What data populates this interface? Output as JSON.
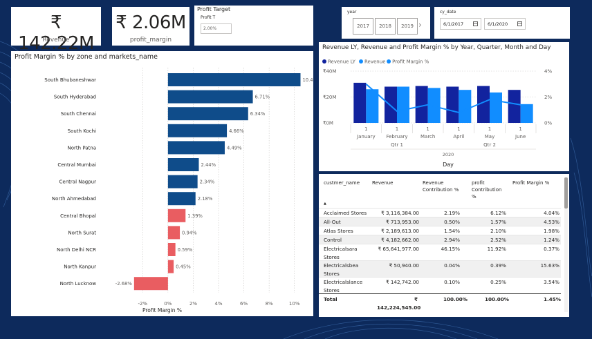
{
  "kpis": {
    "revenue": {
      "value": "₹ 142.22M",
      "label": "Revenue"
    },
    "profit_margin": {
      "value": "₹ 2.06M",
      "label": "profit_margin"
    }
  },
  "profit_target": {
    "title": "Profit Target",
    "sub_label": "Profit T",
    "value": "2.00%"
  },
  "year_slicer": {
    "label": "year",
    "options": [
      "2017",
      "2018",
      "2019"
    ]
  },
  "date_slicer": {
    "label": "cy_date",
    "start": "6/1/2017",
    "end": "6/1/2020"
  },
  "bar_chart": {
    "title": "Profit Margin % by zone and markets_name",
    "xlabel": "Profit Margin %"
  },
  "combo_chart": {
    "title": "Revenue LY, Revenue and Profit Margin % by Year, Quarter, Month and Day",
    "year_label": "2020",
    "axis_title": "Day",
    "quarters": [
      "Qtr 1",
      "Qtr 2"
    ]
  },
  "table": {
    "headers": {
      "customer": "custmer_name",
      "revenue": "Revenue",
      "rev_contrib": [
        "Revenue",
        "Contribution %"
      ],
      "profit_contrib": [
        "profit",
        "Contribution",
        "%"
      ],
      "pm": "Profit Margin %"
    },
    "sort_indicator": "▲",
    "rows": [
      {
        "name": [
          "Acclaimed Stores"
        ],
        "revenue": "₹ 3,116,384.00",
        "rev_contrib": "2.19%",
        "profit_contrib": "6.12%",
        "pm": "4.04%"
      },
      {
        "name": [
          "All-Out"
        ],
        "revenue": "₹ 713,953.00",
        "rev_contrib": "0.50%",
        "profit_contrib": "1.57%",
        "pm": "4.53%"
      },
      {
        "name": [
          "Atlas Stores"
        ],
        "revenue": "₹ 2,189,613.00",
        "rev_contrib": "1.54%",
        "profit_contrib": "2.10%",
        "pm": "1.98%"
      },
      {
        "name": [
          "Control"
        ],
        "revenue": "₹ 4,182,662.00",
        "rev_contrib": "2.94%",
        "profit_contrib": "2.52%",
        "pm": "1.24%"
      },
      {
        "name": [
          "Electricalsara",
          "Stores"
        ],
        "revenue": "₹ 65,641,977.00",
        "rev_contrib": "46.15%",
        "profit_contrib": "11.92%",
        "pm": "0.37%"
      },
      {
        "name": [
          "Electricalsbea",
          "Stores"
        ],
        "revenue": "₹ 50,940.00",
        "rev_contrib": "0.04%",
        "profit_contrib": "0.39%",
        "pm": "15.63%"
      },
      {
        "name": [
          "Electricalslance",
          "Stores"
        ],
        "revenue": "₹ 142,742.00",
        "rev_contrib": "0.10%",
        "profit_contrib": "0.25%",
        "pm": "3.54%"
      }
    ],
    "total": {
      "label": "Total",
      "revenue_symbol": "₹",
      "revenue_value": "142,224,545.00",
      "rev_contrib": "100.00%",
      "profit_contrib": "100.00%",
      "pm": "1.45%"
    }
  },
  "chart_data": [
    {
      "type": "bar",
      "orientation": "horizontal",
      "title": "Profit Margin % by zone and markets_name",
      "xlabel": "Profit Margin %",
      "ylabel": "",
      "categories": [
        "South Bhubaneshwar",
        "South Hyderabad",
        "South Chennai",
        "South Kochi",
        "North Patna",
        "Central Mumbai",
        "Central Nagpur",
        "North Ahmedabad",
        "Central Bhopal",
        "North Surat",
        "North Delhi NCR",
        "North Kanpur",
        "North Lucknow"
      ],
      "values": [
        10.48,
        6.71,
        6.34,
        4.66,
        4.49,
        2.44,
        2.34,
        2.18,
        1.39,
        0.94,
        0.59,
        0.45,
        -2.68
      ],
      "data_labels": [
        "10.48%",
        "6.71%",
        "6.34%",
        "4.66%",
        "4.49%",
        "2.44%",
        "2.34%",
        "2.18%",
        "1.39%",
        "0.94%",
        "0.59%",
        "0.45%",
        "-2.68%"
      ],
      "below_target_threshold": 2.0,
      "colors": {
        "above": "#0f4c8a",
        "below": "#e95d61"
      },
      "xlim": [
        -3,
        11
      ],
      "xticks": [
        -2,
        0,
        2,
        4,
        6,
        8,
        10
      ],
      "xtick_labels": [
        "-2%",
        "0%",
        "2%",
        "4%",
        "6%",
        "8%",
        "10%"
      ],
      "grid": true
    },
    {
      "type": "bar",
      "combo": "clustered column + line",
      "title": "Revenue LY, Revenue and Profit Margin % by Year, Quarter, Month and Day",
      "xlabel": "Day",
      "categories": [
        "January",
        "February",
        "March",
        "April",
        "May",
        "June"
      ],
      "day_labels": [
        "1",
        "1",
        "1",
        "1",
        "1",
        "1"
      ],
      "quarter_groups": [
        {
          "label": "Qtr 1",
          "span": [
            0,
            2
          ]
        },
        {
          "label": "Qtr 2",
          "span": [
            3,
            5
          ]
        }
      ],
      "year": "2020",
      "series": [
        {
          "name": "Revenue LY",
          "axis": "left",
          "values": [
            31,
            28,
            28.5,
            28,
            28.5,
            25.5
          ],
          "color": "#12239e"
        },
        {
          "name": "Revenue",
          "axis": "left",
          "values": [
            26,
            28,
            27,
            25.5,
            23.5,
            14.5
          ],
          "color": "#118dff"
        },
        {
          "name": "Profit Margin %",
          "axis": "right",
          "type": "line",
          "values": [
            3.0,
            0.9,
            1.4,
            0.8,
            1.8,
            1.4
          ],
          "color": "#118dff"
        }
      ],
      "ylim_left": [
        0,
        40
      ],
      "yticks_left": [
        "₹0M",
        "₹20M",
        "₹40M"
      ],
      "ylim_right": [
        0,
        4
      ],
      "yticks_right": [
        "0%",
        "2%",
        "4%"
      ],
      "legend": "top-left"
    }
  ]
}
